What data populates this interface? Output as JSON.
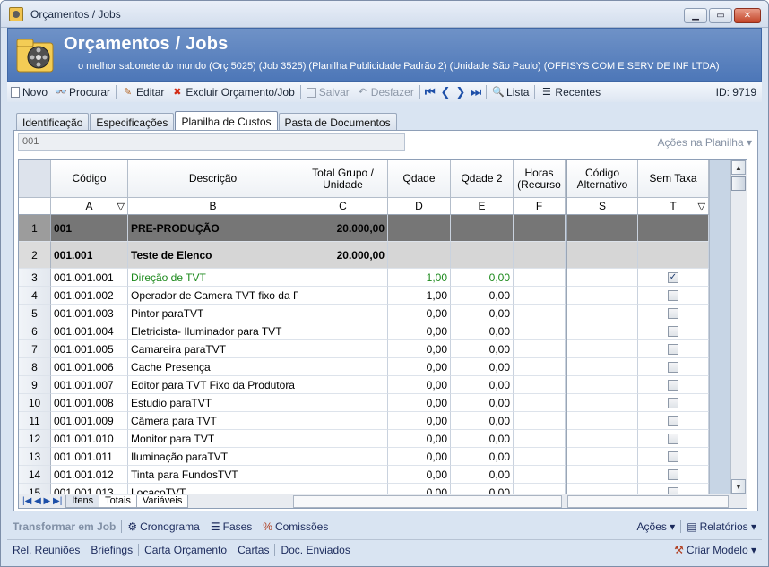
{
  "window": {
    "title": "Orçamentos / Jobs"
  },
  "banner": {
    "title": "Orçamentos / Jobs",
    "subtitle": "o melhor sabonete do mundo (Orç 5025) (Job 3525)  (Planilha Publicidade Padrão 2) (Unidade São Paulo) (OFFISYS COM E SERV DE INF LTDA)"
  },
  "toolbar": {
    "novo": "Novo",
    "procurar": "Procurar",
    "editar": "Editar",
    "excluir": "Excluir Orçamento/Job",
    "salvar": "Salvar",
    "desfazer": "Desfazer",
    "lista": "Lista",
    "recentes": "Recentes",
    "id": "ID: 9719"
  },
  "tabs": [
    "Identificação",
    "Especificações",
    "Planilha de Custos",
    "Pasta de Documentos"
  ],
  "code_field": {
    "value": "001"
  },
  "acoes_planilha": "Ações na Planilha",
  "grid": {
    "headers": {
      "codigo": "Código",
      "descricao": "Descrição",
      "total": "Total Grupo / Unidade",
      "qdade": "Qdade",
      "qdade2": "Qdade 2",
      "horas": "Horas (Recurso",
      "codalt": "Código Alternativo",
      "semtaxa": "Sem Taxa"
    },
    "letters": {
      "a": "A",
      "b": "B",
      "c": "C",
      "d": "D",
      "e": "E",
      "f": "F",
      "s": "S",
      "t": "T"
    },
    "rows": [
      {
        "n": "1",
        "code": "001",
        "desc": "PRE-PRODUÇÃO",
        "total": "20.000,00",
        "q": "",
        "q2": "",
        "type": "g1"
      },
      {
        "n": "2",
        "code": "001.001",
        "desc": "Teste de Elenco",
        "total": "20.000,00",
        "q": "",
        "q2": "",
        "type": "g2"
      },
      {
        "n": "3",
        "code": "001.001.001",
        "desc": "Direção de TVT",
        "total": "",
        "q": "1,00",
        "q2": "0,00",
        "type": "item",
        "green": true,
        "checked": true
      },
      {
        "n": "4",
        "code": "001.001.002",
        "desc": "Operador de Camera TVT fixo da Prod",
        "total": "",
        "q": "1,00",
        "q2": "0,00",
        "type": "item"
      },
      {
        "n": "5",
        "code": "001.001.003",
        "desc": "Pintor paraTVT",
        "total": "",
        "q": "0,00",
        "q2": "0,00",
        "type": "item"
      },
      {
        "n": "6",
        "code": "001.001.004",
        "desc": "Eletricista- Iluminador para TVT",
        "total": "",
        "q": "0,00",
        "q2": "0,00",
        "type": "item"
      },
      {
        "n": "7",
        "code": "001.001.005",
        "desc": "Camareira paraTVT",
        "total": "",
        "q": "0,00",
        "q2": "0,00",
        "type": "item"
      },
      {
        "n": "8",
        "code": "001.001.006",
        "desc": "Cache Presença",
        "total": "",
        "q": "0,00",
        "q2": "0,00",
        "type": "item"
      },
      {
        "n": "9",
        "code": "001.001.007",
        "desc": "Editor para TVT Fixo da Produtora",
        "total": "",
        "q": "0,00",
        "q2": "0,00",
        "type": "item"
      },
      {
        "n": "10",
        "code": "001.001.008",
        "desc": "Estudio paraTVT",
        "total": "",
        "q": "0,00",
        "q2": "0,00",
        "type": "item"
      },
      {
        "n": "11",
        "code": "001.001.009",
        "desc": "Câmera para TVT",
        "total": "",
        "q": "0,00",
        "q2": "0,00",
        "type": "item"
      },
      {
        "n": "12",
        "code": "001.001.010",
        "desc": "Monitor para TVT",
        "total": "",
        "q": "0,00",
        "q2": "0,00",
        "type": "item"
      },
      {
        "n": "13",
        "code": "001.001.011",
        "desc": "Iluminação paraTVT",
        "total": "",
        "q": "0,00",
        "q2": "0,00",
        "type": "item"
      },
      {
        "n": "14",
        "code": "001.001.012",
        "desc": "Tinta para FundosTVT",
        "total": "",
        "q": "0,00",
        "q2": "0,00",
        "type": "item"
      },
      {
        "n": "15",
        "code": "001.001.013",
        "desc": "LocaçoTVT",
        "total": "",
        "q": "0,00",
        "q2": "0,00",
        "type": "item"
      }
    ]
  },
  "bottom_tabs": [
    "Itens",
    "Totais",
    "Variáveis"
  ],
  "bottom1": {
    "transformar": "Transformar em Job",
    "cronograma": "Cronograma",
    "fases": "Fases",
    "comissoes": "Comissões",
    "acoes": "Ações",
    "relatorios": "Relatórios"
  },
  "bottom2": {
    "reunioes": "Rel. Reuniões",
    "briefings": "Briefings",
    "carta": "Carta Orçamento",
    "cartas": "Cartas",
    "doc": "Doc. Enviados",
    "criar": "Criar Modelo"
  }
}
